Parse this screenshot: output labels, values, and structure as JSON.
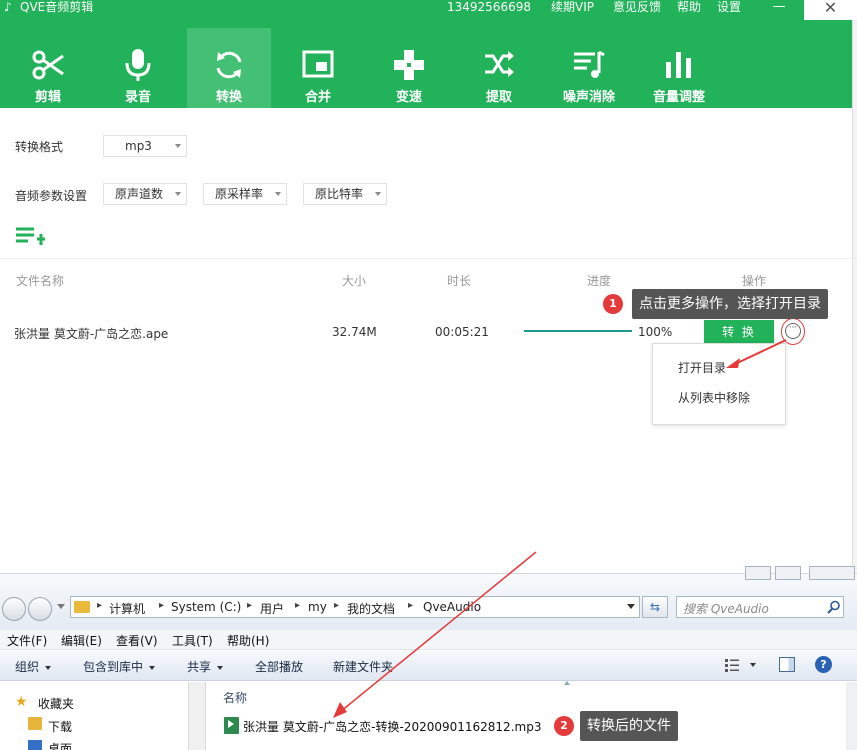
{
  "app": {
    "title": "QVE音频剪辑",
    "phone": "13492566698",
    "links": [
      "续期VIP",
      "意见反馈",
      "帮助",
      "设置"
    ],
    "window_controls": [
      "—",
      "✕"
    ]
  },
  "toolbar": {
    "active": "转换",
    "items": [
      {
        "label": "剪辑",
        "icon": "scissors-icon"
      },
      {
        "label": "录音",
        "icon": "microphone-icon"
      },
      {
        "label": "转换",
        "icon": "convert-arrows-icon"
      },
      {
        "label": "合并",
        "icon": "merge-window-icon"
      },
      {
        "label": "变速",
        "icon": "gamepad-icon"
      },
      {
        "label": "提取",
        "icon": "shuffle-icon"
      },
      {
        "label": "噪声消除",
        "icon": "noise-list-icon"
      },
      {
        "label": "音量调整",
        "icon": "volume-bars-icon"
      }
    ]
  },
  "settings": {
    "format_label": "转换格式",
    "format_value": "mp3",
    "params_label": "音频参数设置",
    "channels_value": "原声道数",
    "samplerate_value": "原采样率",
    "bitrate_value": "原比特率"
  },
  "table": {
    "headers": {
      "name": "文件名称",
      "size": "大小",
      "duration": "时长",
      "progress": "进度",
      "action": "操作"
    },
    "row": {
      "name": "张洪量 莫文蔚-广岛之恋.ape",
      "size": "32.74M",
      "duration": "00:05:21",
      "progress_text": "100%",
      "progress": 1.0,
      "convert_label": "转 换",
      "more_label": "···"
    }
  },
  "context_menu": {
    "items": [
      "打开目录",
      "从列表中移除"
    ]
  },
  "callouts": {
    "one": {
      "badge": "1",
      "text": "点击更多操作，选择打开目录"
    },
    "two": {
      "badge": "2",
      "text": "转换后的文件"
    }
  },
  "explorer": {
    "breadcrumbs": [
      "计算机",
      "System (C:)",
      "用户",
      "my",
      "我的文档",
      "QveAudio"
    ],
    "search_placeholder": "搜索 QveAudio",
    "menu": [
      "文件(F)",
      "编辑(E)",
      "查看(V)",
      "工具(T)",
      "帮助(H)"
    ],
    "commands": [
      "组织",
      "包含到库中",
      "共享",
      "全部播放",
      "新建文件夹"
    ],
    "nav": {
      "favorites": "收藏夹",
      "downloads": "下载",
      "desktop": "桌面"
    },
    "column_name": "名称",
    "file": "张洪量 莫文蔚-广岛之恋-转换-20200901162812.mp3"
  },
  "colors": {
    "brand_green": "#21b25a",
    "active_tab": "#44c074",
    "annotation_red": "#e53a3a",
    "callout_gray": "#555555"
  }
}
